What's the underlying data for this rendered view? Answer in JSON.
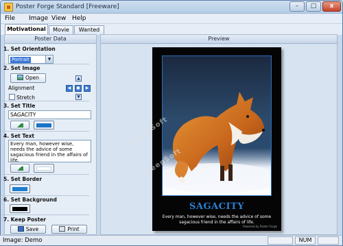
{
  "window": {
    "title": "Poster Forge Standard [Freeware]"
  },
  "menu": {
    "file": "File",
    "image": "Image",
    "view": "View",
    "help": "Help"
  },
  "tabs": [
    "Motivational",
    "Movie",
    "Wanted"
  ],
  "left_panel": {
    "header": "Poster Data",
    "orientation": {
      "label": "1. Set Orientation",
      "value": "Portrait"
    },
    "image": {
      "label": "2. Set Image",
      "open_button": "Open",
      "alignment_label": "Alignment",
      "stretch_label": "Stretch",
      "stretch_checked": false
    },
    "title": {
      "label": "3. Set Title",
      "value": "SAGACITY",
      "color": "#1c74c4"
    },
    "text": {
      "label": "4. Set Text",
      "value": "Every man, however wise, needs the advice of some sagacious friend in the affairs of life.",
      "color": "#ffffff"
    },
    "border": {
      "label": "5. Set Border",
      "color": "#1f7ccf"
    },
    "background": {
      "label": "6. Set Background",
      "color": "#000000"
    },
    "keep": {
      "label": "7. Keep Poster",
      "save_button": "Save",
      "print_button": "Print"
    }
  },
  "preview": {
    "header": "Preview",
    "poster_title": "SAGACITY",
    "poster_text": "Every man, however wise, needs the advice of some sagacious friend in the affairs of life.",
    "credit": "Powered by Poster Forge",
    "watermark": "GreenSoft"
  },
  "status": {
    "text": "Image: Demo",
    "num": "NUM"
  },
  "icons": [
    "app-icon",
    "minimize-icon",
    "maximize-icon",
    "close-icon",
    "dropdown-arrow-icon",
    "image-icon",
    "align-top-icon",
    "align-bottom-icon",
    "align-left-icon",
    "align-center-icon",
    "align-right-icon",
    "font-icon",
    "save-icon",
    "print-icon"
  ]
}
